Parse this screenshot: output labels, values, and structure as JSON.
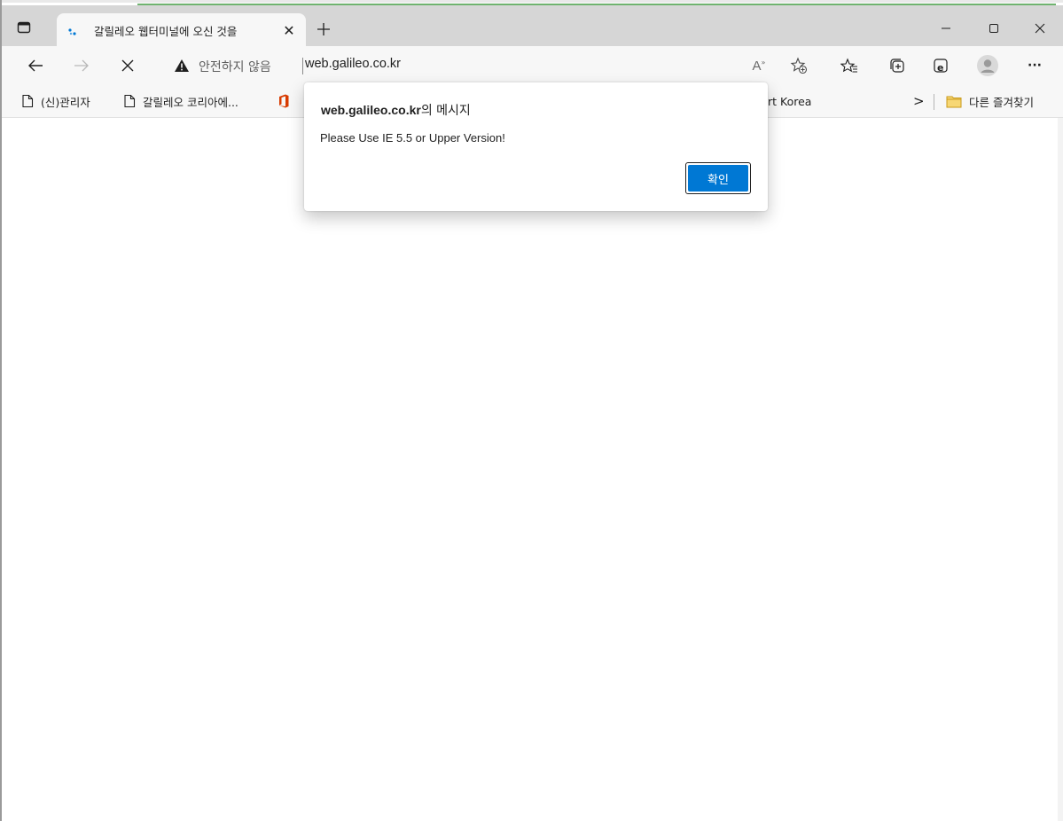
{
  "browser": {
    "tab": {
      "title": "갈릴레오 웹터미널에 오신 것을",
      "close_glyph": "✕"
    },
    "window_controls": {
      "minimize_icon": "minimize-icon",
      "maximize_icon": "maximize-icon",
      "close_icon": "close-icon"
    },
    "address_bar": {
      "security_text": "안전하지 않음",
      "url": "web.galileo.co.kr"
    },
    "toolbar_icons": [
      "read-aloud-icon",
      "add-favorite-icon",
      "favorites-icon",
      "collections-icon",
      "ie-mode-icon",
      "profile-icon",
      "more-icon"
    ],
    "more_glyph": "···",
    "read_aloud_glyph": "A",
    "bookmarks": {
      "items": [
        {
          "label": "(신)관리자",
          "icon": "page-icon"
        },
        {
          "label": "갈릴레오 코리아에...",
          "icon": "page-icon"
        },
        {
          "label": "",
          "icon": "office-icon"
        },
        {
          "label": "rt Korea",
          "icon": ""
        }
      ],
      "overflow_glyph": ">",
      "other_favorites": "다른 즐겨찾기"
    }
  },
  "dialog": {
    "origin": "web.galileo.co.kr",
    "origin_suffix": "의 메시지",
    "message": "Please Use IE 5.5 or Upper Version!",
    "ok_label": "확인"
  },
  "colors": {
    "accent": "#0078d4",
    "tab_strip": "#d6d6d6",
    "toolbar": "#f7f7f7"
  }
}
